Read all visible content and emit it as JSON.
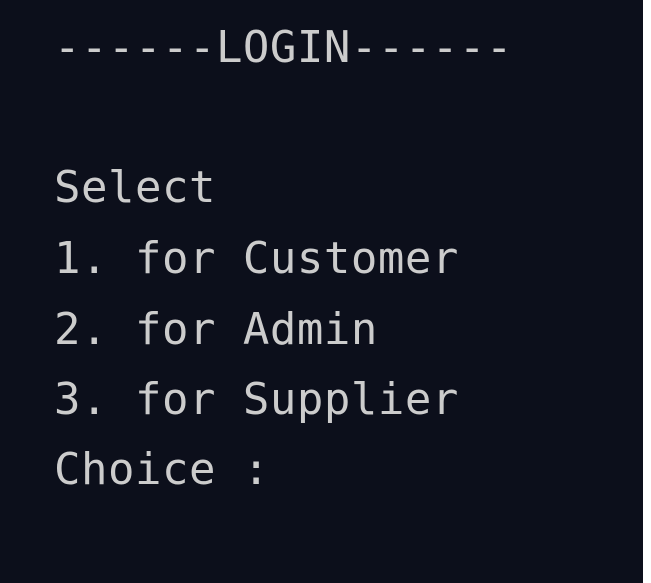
{
  "terminal": {
    "header": "------LOGIN------",
    "prompt": "Select",
    "options": [
      {
        "label": "1. for Customer"
      },
      {
        "label": "2. for Admin"
      },
      {
        "label": "3. for Supplier"
      }
    ],
    "input_prompt": "Choice :",
    "input_value": ""
  },
  "colors": {
    "background": "#0c0f1b",
    "text": "#cccccc"
  }
}
